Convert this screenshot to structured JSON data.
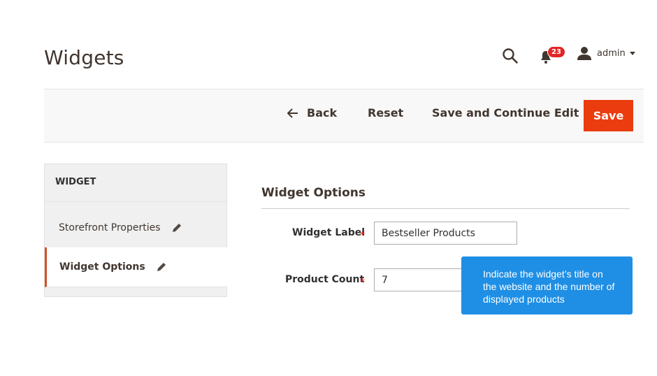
{
  "header": {
    "title": "Widgets",
    "notifications_count": "23",
    "user_name": "admin",
    "icons": {
      "search": "search-icon",
      "notifications": "bell-icon",
      "user": "user-icon",
      "caret": "caret-down-icon"
    }
  },
  "toolbar": {
    "back_label": "Back",
    "reset_label": "Reset",
    "save_continue_label": "Save and Continue Edit",
    "save_label": "Save",
    "save_color": "#eb3c0f"
  },
  "sidebar": {
    "title": "WIDGET",
    "items": [
      {
        "label": "Storefront Properties",
        "active": false
      },
      {
        "label": "Widget Options",
        "active": true
      }
    ],
    "active_accent": "#d25028"
  },
  "main": {
    "section_title": "Widget Options",
    "fields": [
      {
        "label": "Widget Label",
        "required": "*",
        "value": "Bestseller Products"
      },
      {
        "label": "Product Count",
        "required": "*",
        "value": "7"
      }
    ]
  },
  "tooltip": {
    "text": "Indicate the widget’s title on the website and the number of displayed products",
    "color": "#1f8fe5"
  }
}
